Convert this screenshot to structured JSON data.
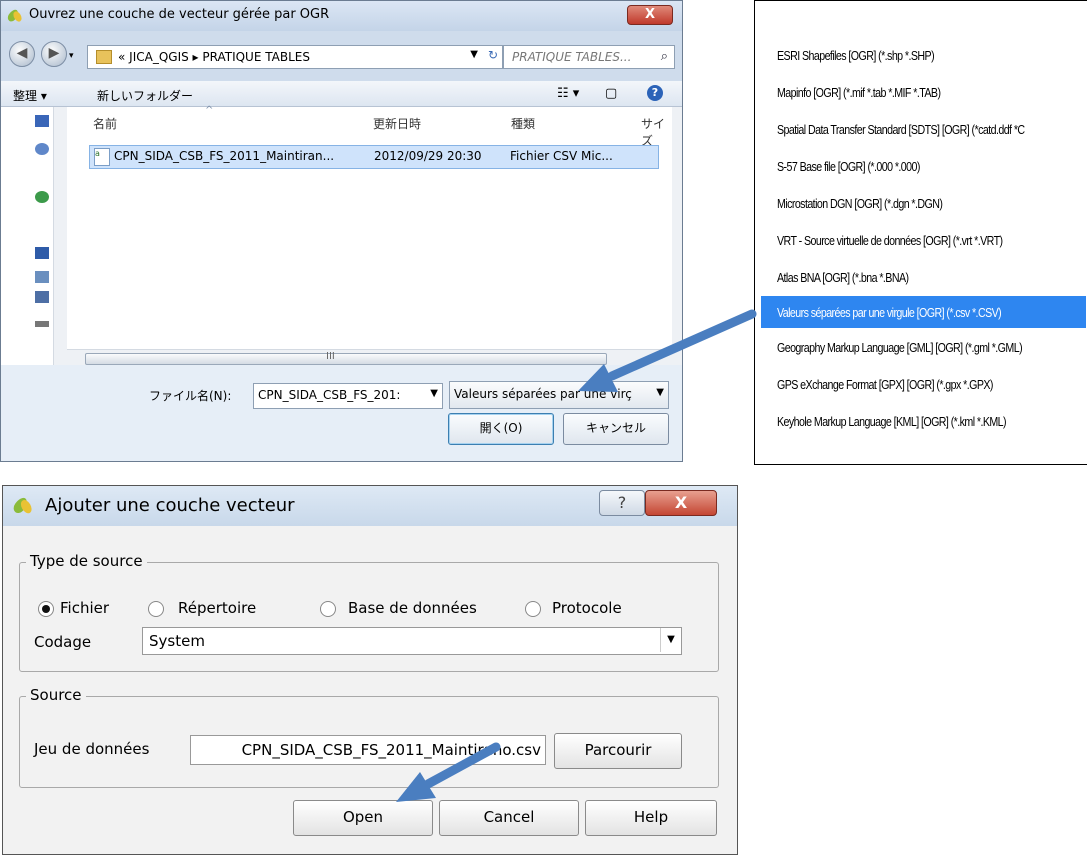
{
  "file_dialog": {
    "title": "Ouvrez une couche de vecteur gérée par OGR",
    "close": "X",
    "breadcrumb": "«  JICA_QGIS  ▸  PRATIQUE TABLES",
    "search_placeholder": "PRATIQUE TABLES...",
    "toolbar": {
      "organize": "整理 ▾",
      "new_folder": "新しいフォルダー"
    },
    "columns": [
      "名前",
      "更新日時",
      "種類",
      "サイズ"
    ],
    "rows": [
      {
        "name": "CPN_SIDA_CSB_FS_2011_Maintiran...",
        "date": "2012/09/29 20:30",
        "type": "Fichier CSV Mic..."
      }
    ],
    "filename_label": "ファイル名(N):",
    "filename_value": "CPN_SIDA_CSB_FS_201:",
    "filetype_value": "Valeurs séparées par une virç",
    "open_button": "開く(O)",
    "cancel_button": "キャンセル",
    "scroll_grip": "III"
  },
  "file_types": {
    "items": [
      "ESRI Shapefiles [OGR] (*.shp *.SHP)",
      "Mapinfo [OGR] (*.mif *.tab *.MIF *.TAB)",
      "Spatial Data Transfer Standard [SDTS] [OGR] (*catd.ddf *C",
      "S-57 Base file [OGR] (*.000 *.000)",
      "Microstation DGN [OGR] (*.dgn *.DGN)",
      "VRT - Source virtuelle de données [OGR] (*.vrt *.VRT)",
      "Atlas BNA [OGR] (*.bna *.BNA)",
      "Valeurs séparées par une virgule [OGR] (*.csv *.CSV)",
      "Geography Markup Language [GML] [OGR] (*.gml *.GML)",
      "GPS eXchange Format [GPX] [OGR] (*.gpx *.GPX)",
      "Keyhole Markup Language [KML] [OGR] (*.kml *.KML)"
    ],
    "selected_index": 7,
    "selected_color": "#2e86f0"
  },
  "add_layer_dialog": {
    "title": "Ajouter une couche vecteur",
    "help_glyph": "?",
    "close": "X",
    "source_type_group": "Type de source",
    "radios": [
      {
        "label": "Fichier",
        "checked": true
      },
      {
        "label": "Répertoire",
        "checked": false
      },
      {
        "label": "Base de données",
        "checked": false
      },
      {
        "label": "Protocole",
        "checked": false
      }
    ],
    "encoding_label": "Codage",
    "encoding_value": "System",
    "source_group": "Source",
    "dataset_label": "Jeu de données",
    "dataset_value": "CPN_SIDA_CSB_FS_2011_Maintirano.csv",
    "browse_button": "Parcourir",
    "open_button": "Open",
    "cancel_button": "Cancel",
    "help_button": "Help"
  },
  "annotation_color": "#4a7ec0"
}
